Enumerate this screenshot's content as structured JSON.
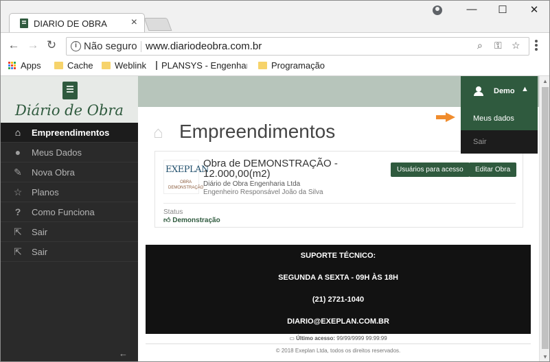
{
  "browser": {
    "tab_title": "DIARIO DE OBRA",
    "security": "Não seguro",
    "url": "www.diariodeobra.com.br",
    "bookmarks": [
      {
        "label": "Apps"
      },
      {
        "label": "Cache"
      },
      {
        "label": "Weblink"
      },
      {
        "label": "PLANSYS - Engenhar"
      },
      {
        "label": "Programação"
      }
    ]
  },
  "app": {
    "brand": "Diário de Obra",
    "accent_color": "#2f5a3e",
    "sidebar": [
      {
        "label": "Empreendimentos",
        "icon": "home-icon"
      },
      {
        "label": "Meus Dados",
        "icon": "user-icon"
      },
      {
        "label": "Nova Obra",
        "icon": "edit-icon"
      },
      {
        "label": "Planos",
        "icon": "star-icon"
      },
      {
        "label": "Como Funciona",
        "icon": "question-icon"
      },
      {
        "label": "Sair",
        "icon": "share-icon"
      },
      {
        "label": "Sair",
        "icon": "share-icon"
      }
    ],
    "collapse_glyph": "←"
  },
  "user_menu": {
    "name": "Demo",
    "items": [
      "Meus dados",
      "Sair"
    ]
  },
  "main": {
    "title": "Empreendimentos",
    "obra": {
      "logo_text": "EXEPLAN",
      "logo_sub": "OBRA DEMONSTRAÇÃO",
      "name": "Obra de DEMONSTRAÇÃO - 12.000,00(m2)",
      "company": "Diário de Obra Engenharia Ltda",
      "engineer": "Engenheiro Responsável João da Silva",
      "status_label": "Status",
      "status_value": "Demonstração",
      "btn_users": "Usuários para acesso",
      "btn_edit": "Editar Obra"
    },
    "support": {
      "title": "SUPORTE TÉCNICO:",
      "hours": "SEGUNDA A SEXTA - 09H ÀS 18H",
      "phone": "(21) 2721-1040",
      "email": "DIARIO@EXEPLAN.COM.BR"
    },
    "last_access_label": "Último acesso:",
    "last_access_value": "99/99/9999 99:99:99",
    "copyright": "© 2018 Exeplan Ltda, todos os direitos reservados."
  }
}
